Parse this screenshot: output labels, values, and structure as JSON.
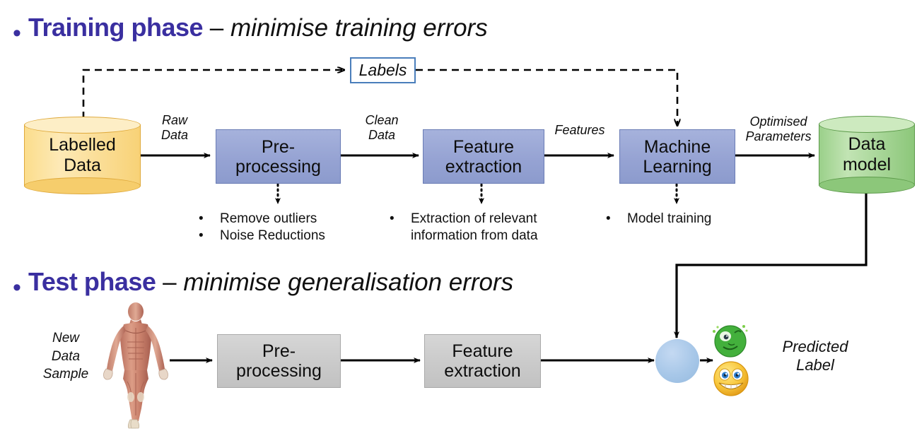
{
  "slide": {
    "background": "#ffffff",
    "accent_purple": "#3a2fa0"
  },
  "headings": {
    "training": {
      "bullet": "•",
      "strong": "Training phase",
      "dash": " – ",
      "italic": "minimise training errors"
    },
    "test": {
      "bullet": "•",
      "strong": "Test phase",
      "dash": " – ",
      "italic": "minimise generalisation errors"
    }
  },
  "training_phase": {
    "source": {
      "label": "Labelled\nData",
      "color": "#f8d277",
      "border": "#dfa93b",
      "shape": "cylinder"
    },
    "labels_box": {
      "label": "Labels",
      "border": "#4a7ebb",
      "fill": "#ffffff"
    },
    "stages": [
      {
        "label": "Pre-\nprocessing",
        "fill": "#96a3d3",
        "border": "#6a7cb5"
      },
      {
        "label": "Feature\nextraction",
        "fill": "#96a3d3",
        "border": "#6a7cb5"
      },
      {
        "label": "Machine\nLearning",
        "fill": "#96a3d3",
        "border": "#6a7cb5"
      }
    ],
    "output": {
      "label": "Data\nmodel",
      "color": "#8cc77a",
      "border": "#5c9a4a",
      "shape": "cylinder"
    },
    "edge_captions": [
      {
        "text": "Raw\nData"
      },
      {
        "text": "Clean\nData"
      },
      {
        "text": "Features"
      },
      {
        "text": "Optimised\nParameters"
      }
    ],
    "notes": [
      {
        "bullet": "•",
        "items": [
          "Remove outliers",
          "Noise Reductions"
        ]
      },
      {
        "bullet": "•",
        "items": [
          "Extraction of relevant\ninformation from data"
        ]
      },
      {
        "bullet": "•",
        "items": [
          "Model training"
        ]
      }
    ]
  },
  "test_phase": {
    "input": {
      "label": "New\nData\nSample",
      "image": "human-muscle-figure"
    },
    "stages": [
      {
        "label": "Pre-\nprocessing",
        "fill": "#cacaca",
        "border": "#a9a9a9"
      },
      {
        "label": "Feature\nextraction",
        "fill": "#cacaca",
        "border": "#a9a9a9"
      }
    ],
    "classifier_node": {
      "fill": "#a7c7e8",
      "shape": "circle"
    },
    "outcomes": [
      {
        "icon": "sick-green-face-icon",
        "color": "#3fae3f"
      },
      {
        "icon": "grinning-yellow-face-icon",
        "color": "#f2c53d"
      }
    ],
    "output_label": "Predicted\nLabel"
  },
  "icons": {
    "arrow": "arrow-head",
    "dashed_feedback": "dashed-feedback-arrow",
    "dotted_note": "dotted-note-arrow"
  }
}
